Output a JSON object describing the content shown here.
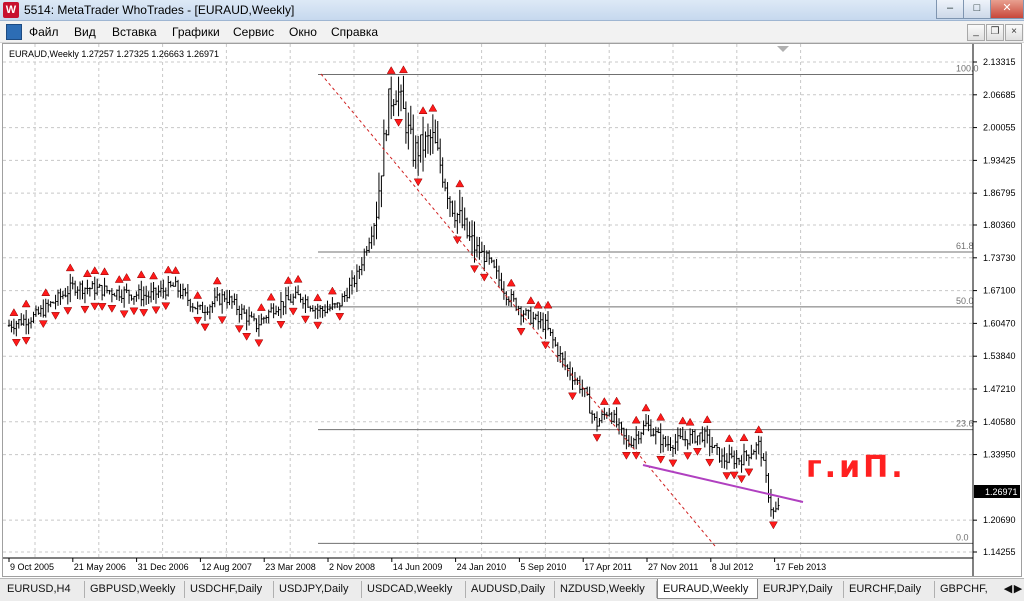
{
  "window": {
    "title": "5514: MetaTrader WhoTrades - [EURAUD,Weekly]",
    "app_icon_letter": "W",
    "minimize_glyph": "–",
    "maximize_glyph": "□",
    "close_glyph": "✕"
  },
  "menu": {
    "items": [
      "Файл",
      "Вид",
      "Вставка",
      "Графики",
      "Сервис",
      "Окно",
      "Справка"
    ],
    "mdi_minimize_glyph": "_",
    "mdi_restore_glyph": "❐",
    "mdi_close_glyph": "×"
  },
  "chart": {
    "header": "EURAUD,Weekly  1.27257 1.27325 1.26663 1.26971",
    "current_price": "1.26971",
    "price_labels": [
      "2.13315",
      "2.06685",
      "2.00055",
      "1.93425",
      "1.86795",
      "1.80360",
      "1.73730",
      "1.67100",
      "1.60470",
      "1.53840",
      "1.47210",
      "1.40580",
      "1.33950",
      "1.20690",
      "1.14255"
    ],
    "date_labels": [
      "9 Oct 2005",
      "21 May 2006",
      "31 Dec 2006",
      "12 Aug 2007",
      "23 Mar 2008",
      "2 Nov 2008",
      "14 Jun 2009",
      "24 Jan 2010",
      "5 Sep 2010",
      "17 Apr 2011",
      "27 Nov 2011",
      "8 Jul 2012",
      "17 Feb 2013"
    ],
    "fib_levels": [
      {
        "label": "100.0",
        "price": 2.108
      },
      {
        "label": "61.8",
        "price": 1.749
      },
      {
        "label": "50.0",
        "price": 1.638
      },
      {
        "label": "23.6",
        "price": 1.39
      },
      {
        "label": "0.0",
        "price": 1.16
      }
    ],
    "colors": {
      "bars": "#000000",
      "fractals": "#ff0000",
      "trendline": "#b040c0",
      "annotation": "#ff2020",
      "fib": "#707070"
    }
  },
  "annotation": {
    "text": "г.иП."
  },
  "tabs": [
    "EURUSD,H4",
    "GBPUSD,Weekly",
    "USDCHF,Daily",
    "USDJPY,Daily",
    "USDCAD,Weekly",
    "AUDUSD,Daily",
    "NZDUSD,Weekly",
    "EURAUD,Weekly",
    "EURJPY,Daily",
    "EURCHF,Daily",
    "GBPCHF,"
  ],
  "active_tab": "EURAUD,Weekly",
  "chart_data": {
    "type": "ohlc",
    "x": [
      "9 Oct 2005",
      "21 May 2006",
      "31 Dec 2006",
      "12 Aug 2007",
      "23 Mar 2008",
      "2 Nov 2008",
      "14 Jun 2009",
      "24 Jan 2010",
      "5 Sep 2010",
      "17 Apr 2011",
      "27 Nov 2011",
      "8 Jul 2012",
      "17 Feb 2013"
    ],
    "close_path": [
      [
        2005.77,
        1.6
      ],
      [
        2006.0,
        1.62
      ],
      [
        2006.3,
        1.68
      ],
      [
        2006.6,
        1.67
      ],
      [
        2006.9,
        1.66
      ],
      [
        2007.1,
        1.68
      ],
      [
        2007.3,
        1.63
      ],
      [
        2007.5,
        1.66
      ],
      [
        2007.75,
        1.6
      ],
      [
        2007.9,
        1.64
      ],
      [
        2008.1,
        1.66
      ],
      [
        2008.25,
        1.63
      ],
      [
        2008.4,
        1.64
      ],
      [
        2008.55,
        1.7
      ],
      [
        2008.7,
        1.82
      ],
      [
        2008.8,
        2.05
      ],
      [
        2008.87,
        2.08
      ],
      [
        2009.0,
        1.95
      ],
      [
        2009.15,
        1.98
      ],
      [
        2009.3,
        1.85
      ],
      [
        2009.45,
        1.77
      ],
      [
        2009.6,
        1.73
      ],
      [
        2009.75,
        1.66
      ],
      [
        2009.9,
        1.62
      ],
      [
        2010.05,
        1.6
      ],
      [
        2010.2,
        1.52
      ],
      [
        2010.35,
        1.47
      ],
      [
        2010.45,
        1.4
      ],
      [
        2010.55,
        1.43
      ],
      [
        2010.7,
        1.36
      ],
      [
        2010.85,
        1.4
      ],
      [
        2011.0,
        1.36
      ],
      [
        2011.15,
        1.37
      ],
      [
        2011.3,
        1.38
      ],
      [
        2011.45,
        1.33
      ],
      [
        2011.6,
        1.33
      ],
      [
        2011.75,
        1.36
      ],
      [
        2011.85,
        1.22
      ],
      [
        2011.95,
        1.24
      ],
      [
        2012.1,
        1.28
      ],
      [
        2012.25,
        1.27
      ],
      [
        2012.35,
        1.22
      ],
      [
        2012.45,
        1.17
      ],
      [
        2012.55,
        1.19
      ],
      [
        2012.65,
        1.24
      ],
      [
        2012.8,
        1.22
      ],
      [
        2012.9,
        1.26
      ],
      [
        2013.05,
        1.27
      ],
      [
        2013.15,
        1.31
      ],
      [
        2013.25,
        1.27
      ]
    ],
    "ylim": [
      1.14255,
      2.13315
    ],
    "current_price": 1.26971
  }
}
